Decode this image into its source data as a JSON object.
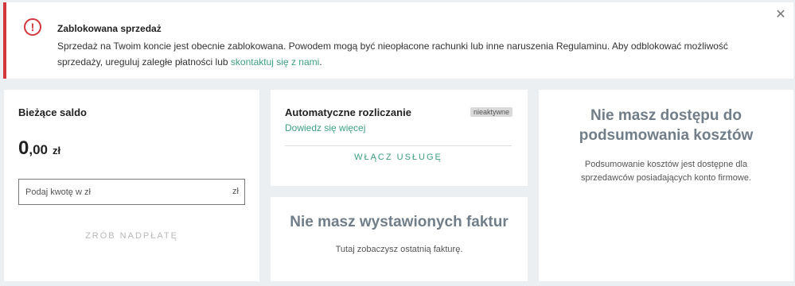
{
  "alert": {
    "title": "Zablokowana sprzedaż",
    "body_text": "Sprzedaż na Twoim koncie jest obecnie zablokowana. Powodem mogą być nieopłacone rachunki lub inne naruszenia Regulaminu. Aby odblokować możliwość sprzedaży, ureguluj zaległe płatności lub ",
    "link_text": "skontaktuj się z nami",
    "suffix": ".",
    "icon": "exclamation-circle-icon",
    "close_icon": "close-icon",
    "accent_color": "#d4373b"
  },
  "balance": {
    "title": "Bieżące saldo",
    "amount_int": "0",
    "amount_dec": ",00",
    "currency": "zł",
    "input_placeholder": "Podaj kwotę w zł",
    "input_unit": "zł",
    "button": "ZRÓB NADPŁATĘ"
  },
  "auto_settlement": {
    "title": "Automatyczne rozliczanie",
    "badge": "nieaktywne",
    "link": "Dowiedz się więcej",
    "button": "WŁĄCZ USŁUGĘ",
    "link_color": "#3e9e84"
  },
  "invoices": {
    "title": "Nie masz wystawionych faktur",
    "text": "Tutaj zobaczysz ostatnią fakturę."
  },
  "costs": {
    "title": "Nie masz dostępu do podsumowania kosztów",
    "text": "Podsumowanie kosztów jest dostępne dla sprzedawców posiadających konto firmowe."
  }
}
